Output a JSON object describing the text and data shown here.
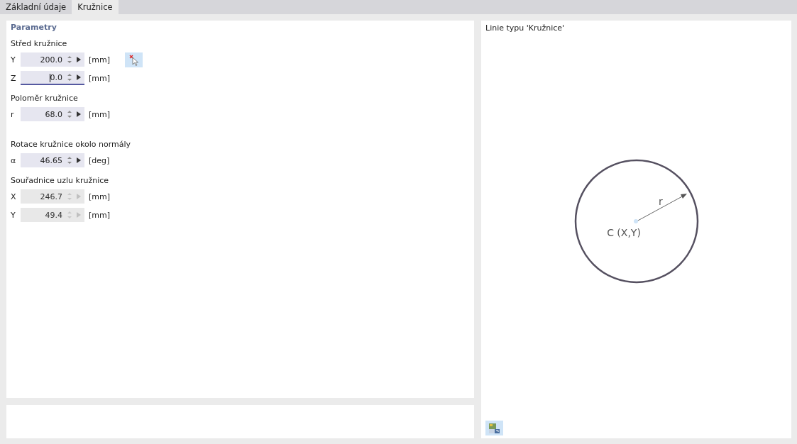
{
  "tabs": [
    {
      "label": "Základní údaje",
      "selected": false
    },
    {
      "label": "Kružnice",
      "selected": true
    }
  ],
  "parameters": {
    "title": "Parametry",
    "groups": [
      {
        "heading": "Střed kružnice",
        "pick_button": true,
        "rows": [
          {
            "label": "Y",
            "value": "200.0",
            "unit": "[mm]",
            "disabled": false,
            "focused": false
          },
          {
            "label": "Z",
            "value": "0.0",
            "unit": "[mm]",
            "disabled": false,
            "focused": true
          }
        ]
      },
      {
        "heading": "Poloměr kružnice",
        "rows": [
          {
            "label": "r",
            "value": "68.0",
            "unit": "[mm]",
            "disabled": false,
            "focused": false
          }
        ]
      },
      {
        "heading": "Rotace kružnice okolo normály",
        "rows": [
          {
            "label": "α",
            "value": "46.65",
            "unit": "[deg]",
            "disabled": false,
            "focused": false
          }
        ]
      },
      {
        "heading": "Souřadnice uzlu kružnice",
        "rows": [
          {
            "label": "X",
            "value": "246.7",
            "unit": "[mm]",
            "disabled": true,
            "focused": false
          },
          {
            "label": "Y",
            "value": "49.4",
            "unit": "[mm]",
            "disabled": true,
            "focused": false
          }
        ]
      }
    ]
  },
  "diagram": {
    "title": "Linie typu 'Kružnice'",
    "radius_label": "r",
    "center_label": "C (X,Y)"
  }
}
